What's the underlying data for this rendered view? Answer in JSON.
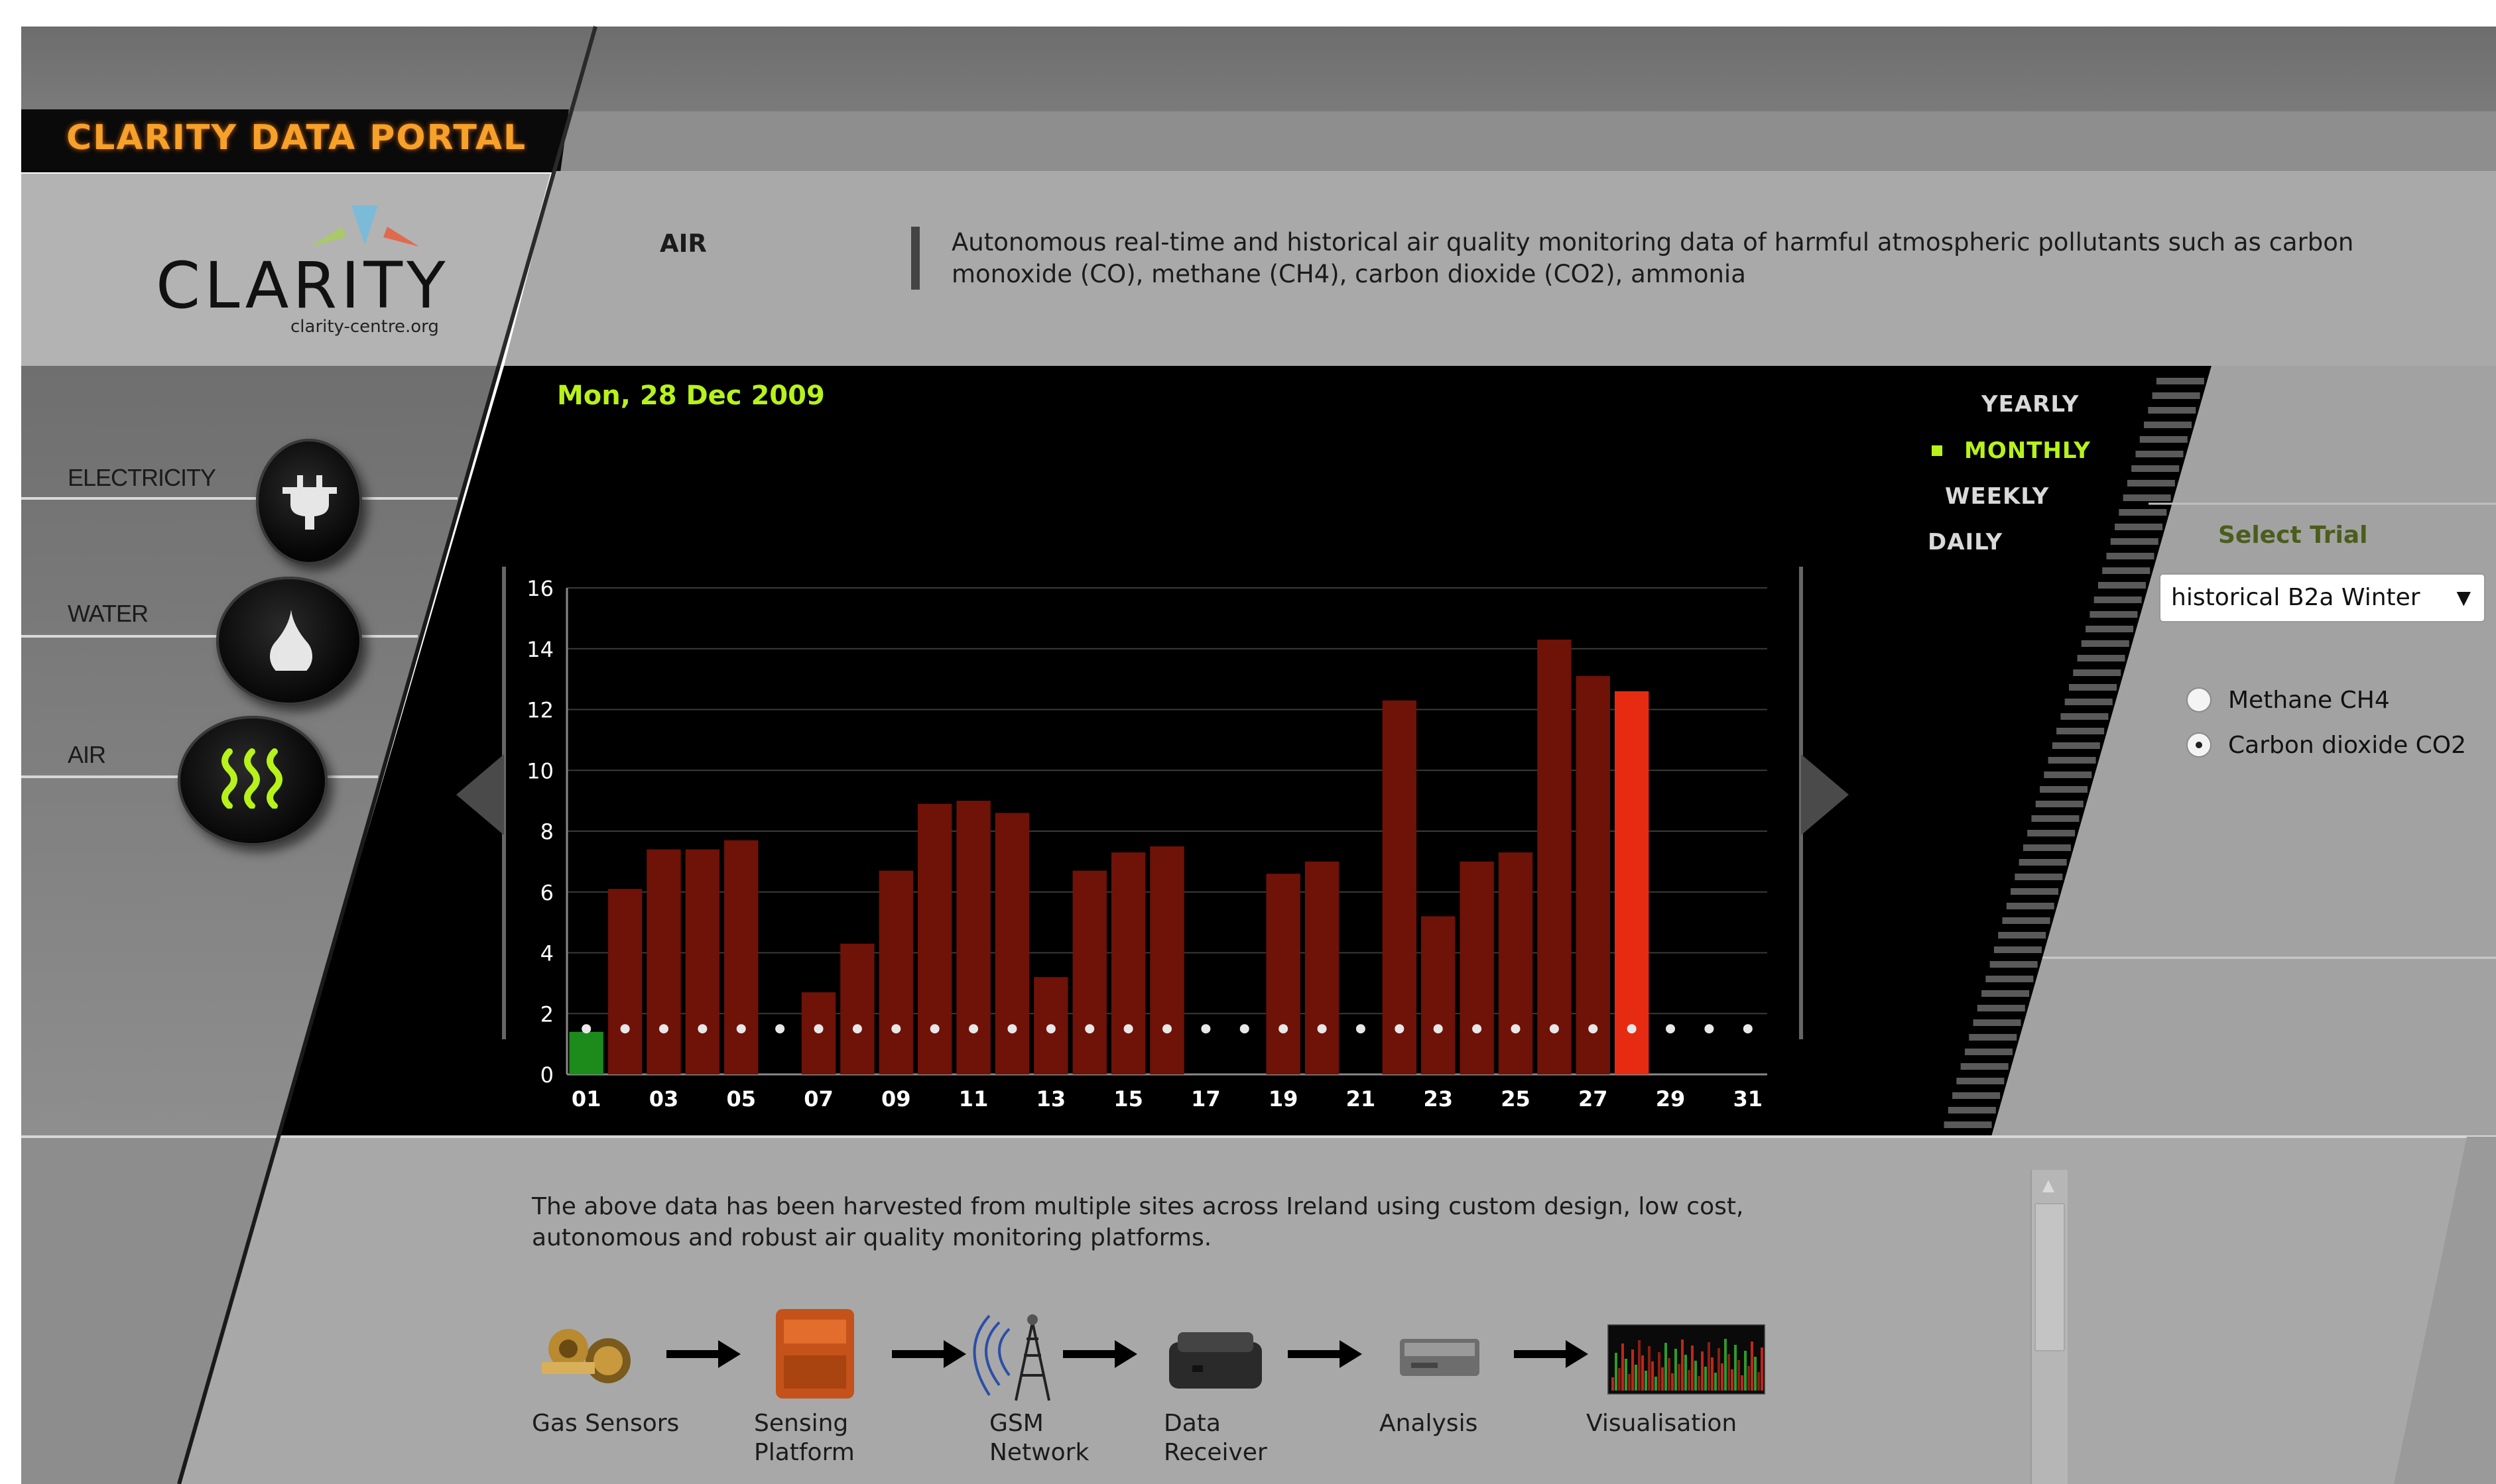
{
  "header": {
    "portal_title": "CLARITY DATA PORTAL",
    "logo_wordmark": "CLARITY",
    "logo_url": "clarity-centre.org",
    "section_title": "AIR",
    "section_description": "Autonomous real-time and historical air quality monitoring data of harmful atmospheric pollutants such as carbon monoxide (CO), methane (CH4), carbon dioxide (CO2), ammonia"
  },
  "nav": {
    "items": [
      {
        "label": "ELECTRICITY",
        "icon": "plug-icon"
      },
      {
        "label": "WATER",
        "icon": "water-drop-icon"
      },
      {
        "label": "AIR",
        "icon": "air-waves-icon"
      }
    ]
  },
  "chart_header": {
    "date": "Mon, 28 Dec 2009",
    "periods": [
      {
        "label": "YEARLY",
        "active": false
      },
      {
        "label": "MONTHLY",
        "active": true
      },
      {
        "label": "WEEKLY",
        "active": false
      },
      {
        "label": "DAILY",
        "active": false
      }
    ]
  },
  "chart_data": {
    "type": "bar",
    "x": [
      1,
      2,
      3,
      4,
      5,
      6,
      7,
      8,
      9,
      10,
      11,
      12,
      13,
      14,
      15,
      16,
      17,
      18,
      19,
      20,
      21,
      22,
      23,
      24,
      25,
      26,
      27,
      28,
      29,
      30,
      31
    ],
    "x_tick_labels": [
      "01",
      "03",
      "05",
      "07",
      "09",
      "11",
      "13",
      "15",
      "17",
      "19",
      "21",
      "23",
      "25",
      "27",
      "29",
      "31"
    ],
    "values": [
      1.4,
      6.1,
      7.4,
      7.4,
      7.7,
      0,
      2.7,
      4.3,
      6.7,
      8.9,
      9.0,
      8.6,
      3.2,
      6.7,
      7.3,
      7.5,
      0,
      0,
      6.6,
      7.0,
      0,
      12.3,
      5.2,
      7.0,
      7.3,
      14.3,
      13.1,
      12.6,
      0,
      0,
      0
    ],
    "marker_days": [
      1,
      2,
      3,
      4,
      5,
      6,
      7,
      8,
      9,
      10,
      11,
      12,
      13,
      14,
      15,
      16,
      17,
      18,
      19,
      20,
      21,
      22,
      23,
      24,
      25,
      26,
      27,
      28,
      29,
      30,
      31
    ],
    "marker_value": 1.5,
    "ylim": [
      0,
      16
    ],
    "y_ticks": [
      0,
      2,
      4,
      6,
      8,
      10,
      12,
      14,
      16
    ],
    "grid": true,
    "colors": {
      "bar": "#6f1208",
      "selected_bar": "#e62b12",
      "first_bar": "#1c8b1c",
      "marker": "#e8e8e8",
      "grid": "#3a3a3a"
    },
    "selected_day": 28,
    "highlight_day": 1
  },
  "trial": {
    "label": "Select Trial",
    "selected": "historical B2a Winter",
    "options": [
      {
        "label": "Methane CH4",
        "checked": false
      },
      {
        "label": "Carbon dioxide CO2",
        "checked": true
      }
    ]
  },
  "info": {
    "text": "The above data has been harvested from multiple sites across Ireland using custom design, low cost, autonomous and robust air quality monitoring platforms.",
    "pipeline": [
      {
        "label": "Gas Sensors",
        "icon": "gas-sensors-icon"
      },
      {
        "label": "Sensing Platform",
        "icon": "sensing-platform-icon"
      },
      {
        "label": "GSM Network",
        "icon": "gsm-tower-icon"
      },
      {
        "label": "Data Receiver",
        "icon": "data-receiver-icon"
      },
      {
        "label": "Analysis",
        "icon": "analysis-device-icon"
      },
      {
        "label": "Visualisation",
        "icon": "visualisation-chart-icon"
      }
    ]
  },
  "theme": {
    "accent_green": "#b7f21a",
    "title_orange": "#f6a12a",
    "panel_dark": "#000000",
    "panel_gray": "#a8a8a8"
  }
}
